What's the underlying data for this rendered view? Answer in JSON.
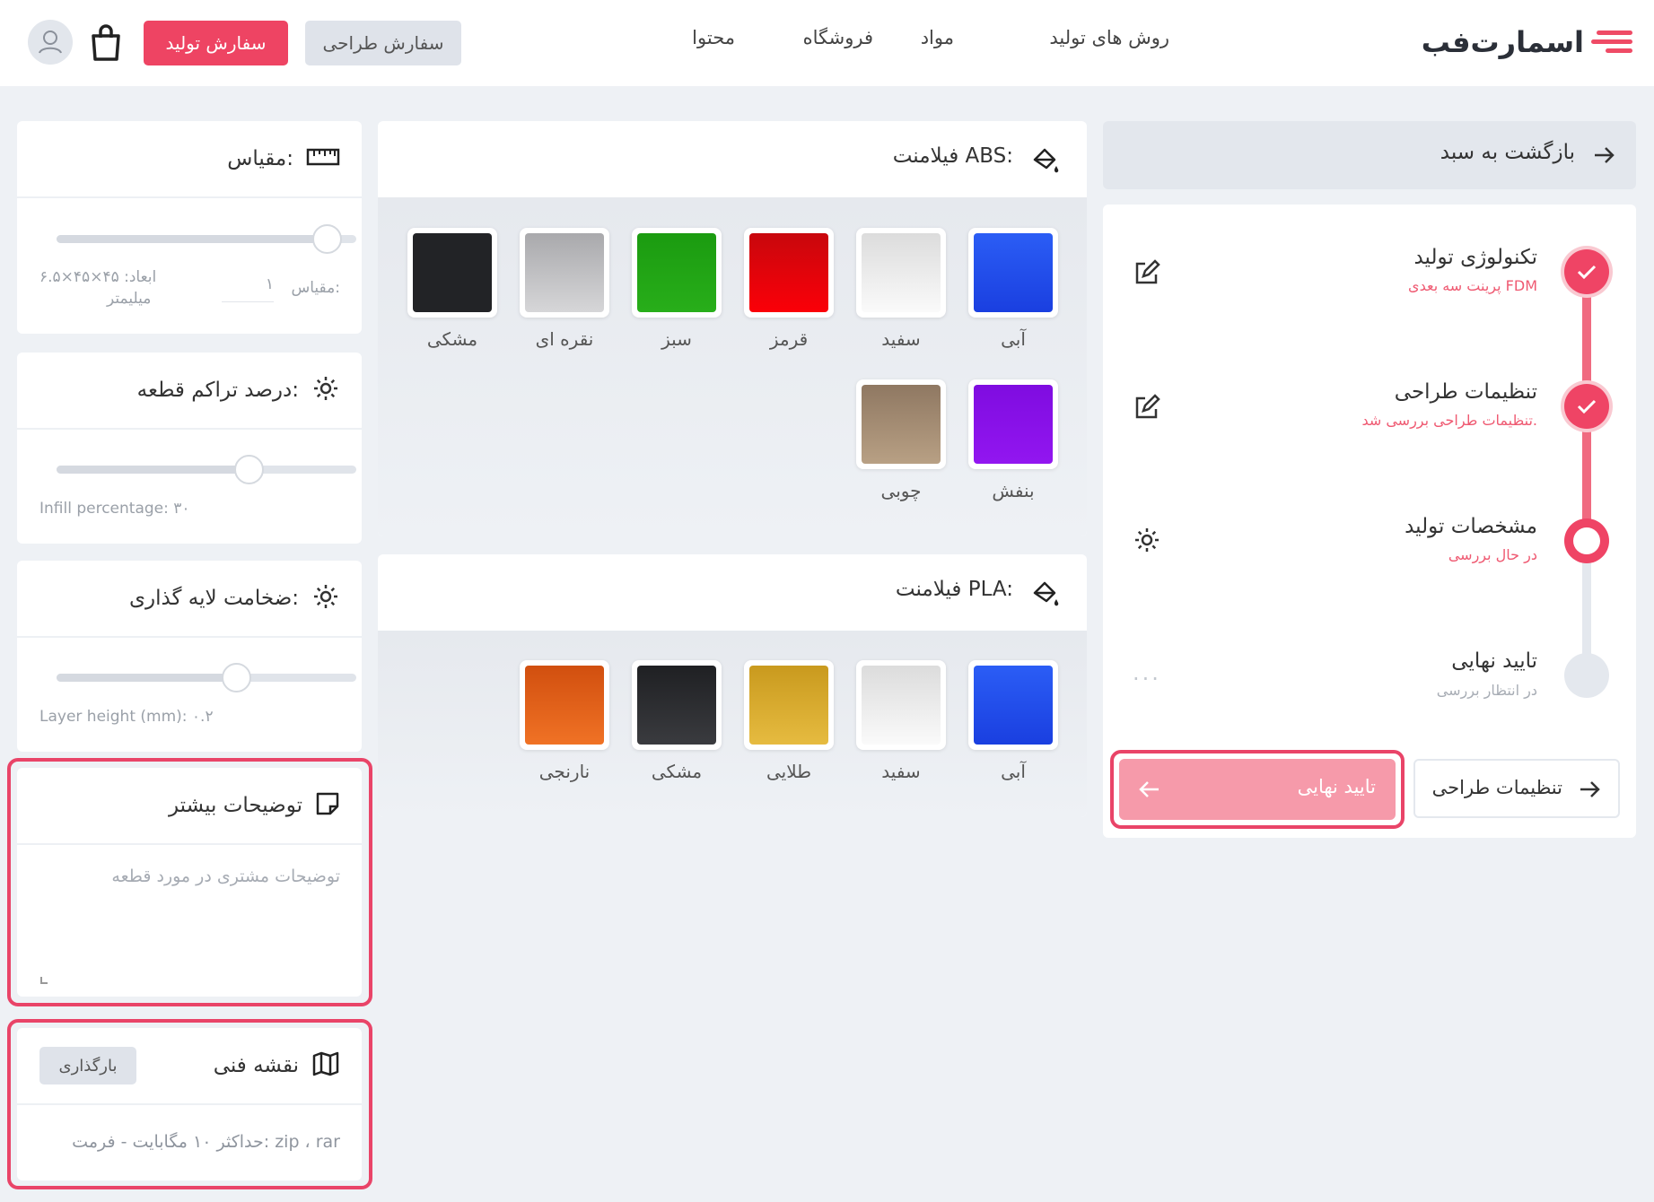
{
  "header": {
    "logo_text": "اسمارت‌فب",
    "nav": [
      "روش های تولید",
      "مواد",
      "فروشگاه",
      "محتوا"
    ],
    "design_order": "سفارش طراحی",
    "production_order": "سفارش تولید"
  },
  "stepper": {
    "back": "بازگشت به سبد",
    "steps": [
      {
        "title": "تکنولوژی تولید",
        "subtitle": "پرینت سه بعدی FDM",
        "status": "done"
      },
      {
        "title": "تنظیمات طراحی",
        "subtitle": "تنظیمات طراحی بررسی شد.",
        "status": "done"
      },
      {
        "title": "مشخصات تولید",
        "subtitle": "در حال بررسی",
        "status": "current"
      },
      {
        "title": "تایید نهایی",
        "subtitle": "در انتظار بررسی",
        "status": "pending"
      }
    ],
    "confirm_label": "تایید نهایی",
    "design_settings_label": "تنظیمات طراحی",
    "more_glyph": "..."
  },
  "abs": {
    "title": "فیلامنت ABS:",
    "colors": [
      {
        "name": "آبی",
        "hex": "#1e4ff0"
      },
      {
        "name": "سفید",
        "hex": "#f2f2f2"
      },
      {
        "name": "قرمز",
        "hex": "#e0040c"
      },
      {
        "name": "سبز",
        "hex": "#1fa614"
      },
      {
        "name": "نقره ای",
        "hex": "#bfbfc2"
      },
      {
        "name": "مشکی",
        "hex": "#222326"
      },
      {
        "name": "بنفش",
        "hex": "#8a0ce6"
      },
      {
        "name": "چوبی",
        "hex": "#a48b74"
      }
    ]
  },
  "pla": {
    "title": "فیلامنت PLA:",
    "colors": [
      {
        "name": "آبی",
        "hex": "#1e4ff0"
      },
      {
        "name": "سفید",
        "hex": "#f2f2f2"
      },
      {
        "name": "طلایی",
        "hex": "#d6a826"
      },
      {
        "name": "مشکی",
        "hex": "#242528"
      },
      {
        "name": "نارنجی",
        "hex": "#e25a14"
      }
    ]
  },
  "scale": {
    "title": "مقیاس:",
    "label": "مقیاس:",
    "value": "۱",
    "dims": "ابعاد: ۴۵×۴۵×۶.۵",
    "unit": "میلیمتر",
    "slider_fraction": 0.9
  },
  "infill": {
    "title": "درصد تراکم قطعه:",
    "caption": "Infill percentage: ۳۰",
    "slider_fraction": 0.64
  },
  "layer": {
    "title": "ضخامت لایه گذاری:",
    "caption": "Layer height (mm): ۰.۲",
    "slider_fraction": 0.6
  },
  "notes": {
    "title": "توضیحات بیشتر",
    "placeholder": "توضیحات مشتری در مورد قطعه"
  },
  "drawing": {
    "title": "نقشه فنی",
    "upload": "بارگذاری",
    "hint": "حداکثر ۱۰ مگابایت - فرمت: zip ، rar"
  }
}
